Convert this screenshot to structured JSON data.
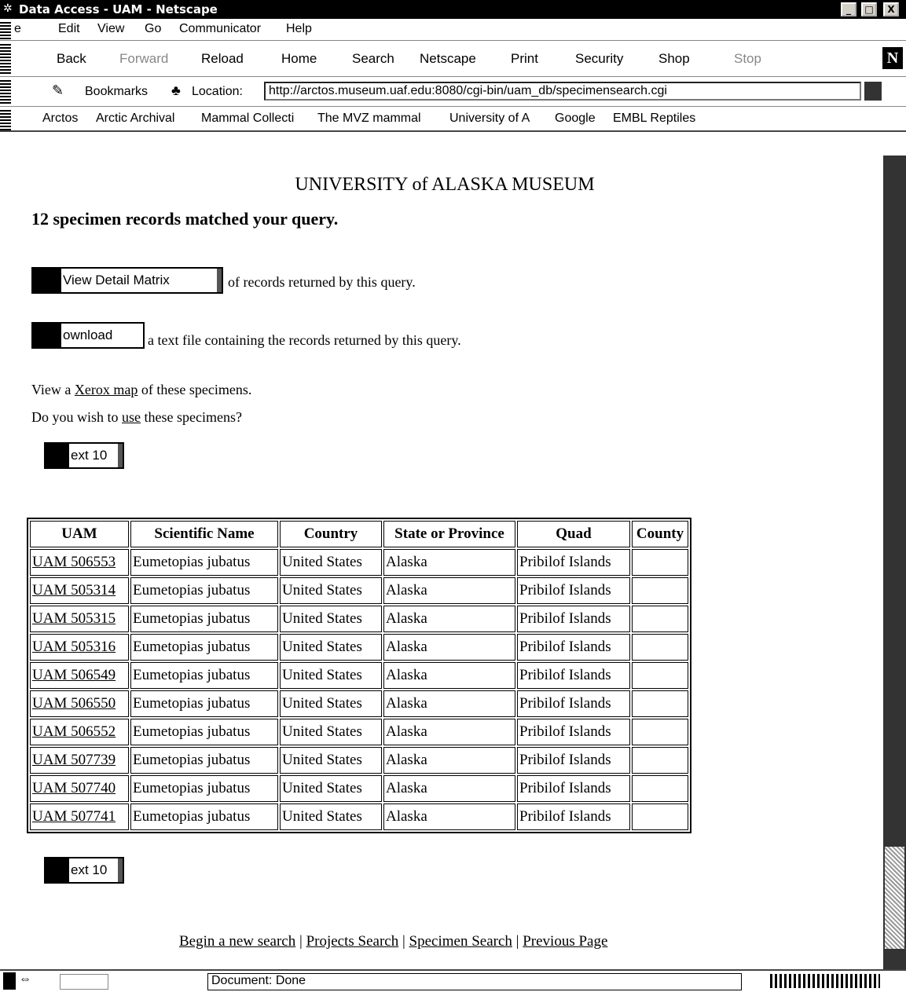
{
  "window": {
    "title": "Data Access - UAM - Netscape",
    "buttons": {
      "minimize": "_",
      "maximize": "□",
      "close": "X"
    }
  },
  "menu": [
    "e",
    "Edit",
    "View",
    "Go",
    "Communicator",
    "Help"
  ],
  "toolbar": {
    "back": "Back",
    "forward": "Forward",
    "reload": "Reload",
    "home": "Home",
    "search": "Search",
    "netscape": "Netscape",
    "print": "Print",
    "security": "Security",
    "shop": "Shop",
    "stop": "Stop",
    "logo": "N"
  },
  "location": {
    "bookmarks": "Bookmarks",
    "location_label": "Location:",
    "url": "http://arctos.museum.uaf.edu:8080/cgi-bin/uam_db/specimensearch.cgi"
  },
  "personal_toolbar": [
    "Arctos",
    "Arctic Archival",
    "Mammal Collecti",
    "The MVZ mammal",
    "University of A",
    "Google",
    "EMBL Reptiles"
  ],
  "page": {
    "heading": "UNIVERSITY of ALASKA MUSEUM",
    "matched": "12 specimen records matched your query.",
    "detail_button": "View Detail Matrix",
    "detail_text": "of records returned by this query.",
    "download_button": "ownload",
    "download_text": "a text file containing the records returned by this query.",
    "map_prefix": "View a ",
    "map_link": "Xerox map",
    "map_suffix": " of these specimens.",
    "use_prefix": "Do you wish to ",
    "use_link": "use",
    "use_suffix": " these specimens?",
    "next_top": "ext 10",
    "next_bottom": "ext 10"
  },
  "table": {
    "headers": [
      "UAM",
      "Scientific Name",
      "Country",
      "State or Province",
      "Quad",
      "County"
    ],
    "rows": [
      [
        "UAM 506553",
        "Eumetopias jubatus",
        "United States",
        "Alaska",
        "Pribilof Islands",
        ""
      ],
      [
        "UAM 505314",
        "Eumetopias jubatus",
        "United States",
        "Alaska",
        "Pribilof Islands",
        ""
      ],
      [
        "UAM 505315",
        "Eumetopias jubatus",
        "United States",
        "Alaska",
        "Pribilof Islands",
        ""
      ],
      [
        "UAM 505316",
        "Eumetopias jubatus",
        "United States",
        "Alaska",
        "Pribilof Islands",
        ""
      ],
      [
        "UAM 506549",
        "Eumetopias jubatus",
        "United States",
        "Alaska",
        "Pribilof Islands",
        ""
      ],
      [
        "UAM 506550",
        "Eumetopias jubatus",
        "United States",
        "Alaska",
        "Pribilof Islands",
        ""
      ],
      [
        "UAM 506552",
        "Eumetopias jubatus",
        "United States",
        "Alaska",
        "Pribilof Islands",
        ""
      ],
      [
        "UAM 507739",
        "Eumetopias jubatus",
        "United States",
        "Alaska",
        "Pribilof Islands",
        ""
      ],
      [
        "UAM 507740",
        "Eumetopias jubatus",
        "United States",
        "Alaska",
        "Pribilof Islands",
        ""
      ],
      [
        "UAM 507741",
        "Eumetopias jubatus",
        "United States",
        "Alaska",
        "Pribilof Islands",
        ""
      ]
    ]
  },
  "footer_links": [
    "Begin a new search",
    "Projects Search",
    "Specimen Search",
    "Previous Page"
  ],
  "footer_sep": "|",
  "status": {
    "text": "Document: Done"
  }
}
